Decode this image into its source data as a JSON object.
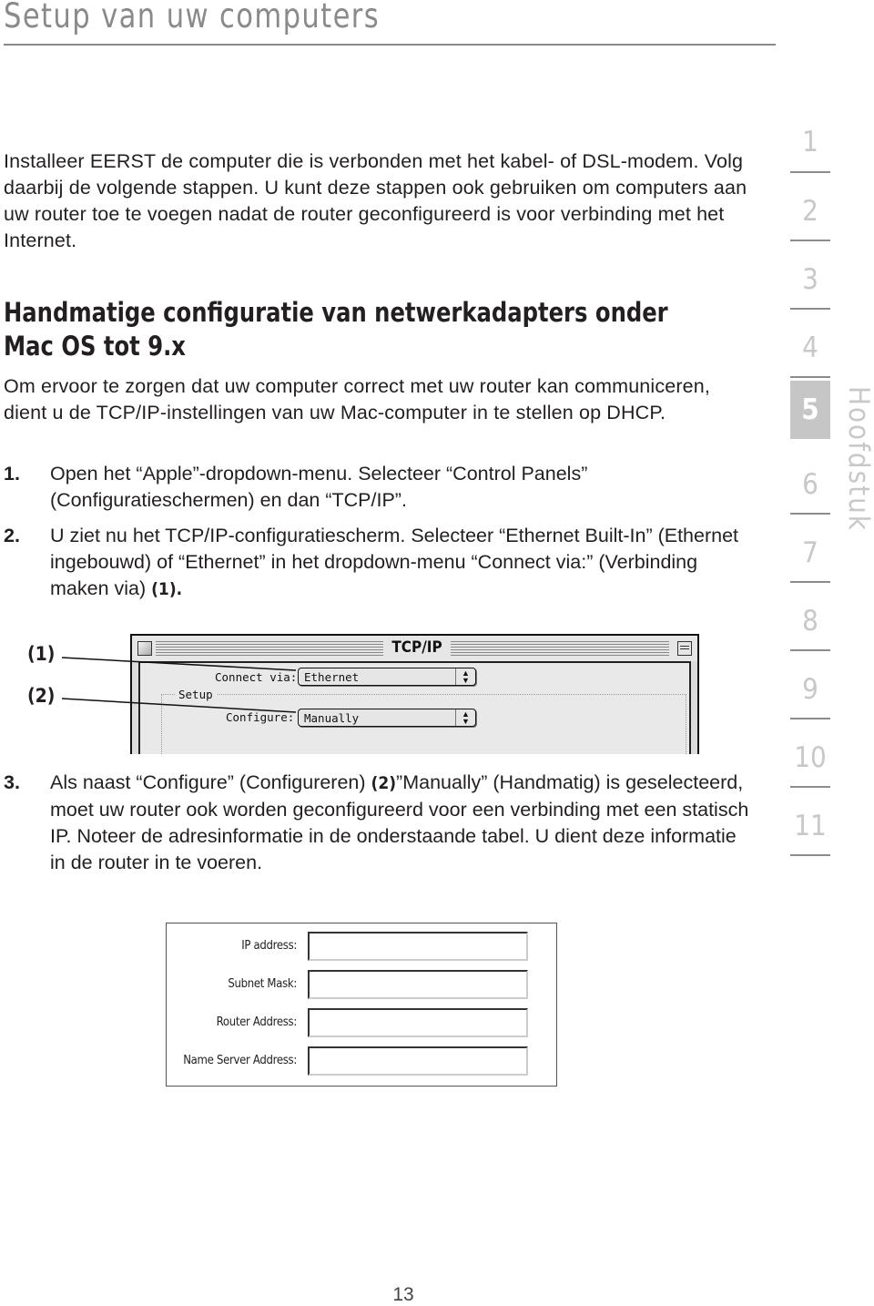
{
  "header": {
    "title": "Setup van uw computers"
  },
  "intro": "Installeer EERST de computer die is verbonden met het kabel- of DSL-modem. Volg daarbij de volgende stappen. U kunt deze stappen ook gebruiken om computers aan uw router toe te voegen nadat de router geconfigureerd is voor verbinding met het Internet.",
  "section": {
    "heading": "Handmatige configuratie van netwerkadapters onder Mac OS tot 9.x",
    "paragraph": "Om ervoor te zorgen dat uw computer correct met uw router kan communiceren, dient u de TCP/IP-instellingen van uw Mac-computer in te stellen op DHCP."
  },
  "steps": [
    {
      "number": "1.",
      "text": "Open het “Apple”-dropdown-menu. Selecteer “Control Panels” (Configuratieschermen) en dan “TCP/IP”."
    },
    {
      "number": "2.",
      "text": "U ziet nu het TCP/IP-configuratiescherm. Selecteer “Ethernet Built-In” (Ethernet ingebouwd) of “Ethernet” in het dropdown-menu “Connect via:” (Verbinding maken via) ",
      "ref": "(1)."
    },
    {
      "number": "3.",
      "text_before": "Als naast “Configure” (Configureren) ",
      "ref": "(2)",
      "text_after": "”Manually” (Handmatig) is geselecteerd, moet uw router ook worden geconfigureerd voor een verbinding met een statisch IP. Noteer de adresinformatie in de onderstaande tabel. U dient deze informatie in de router in te voeren."
    }
  ],
  "dialog": {
    "title": "TCP/IP",
    "callouts": [
      "(1)",
      "(2)"
    ],
    "connect_via_label": "Connect via:",
    "connect_via_value": "Ethernet",
    "setup_group_label": "Setup",
    "configure_label": "Configure:",
    "configure_value": "Manually"
  },
  "address_table": {
    "rows": [
      {
        "label": "IP address:",
        "value": ""
      },
      {
        "label": "Subnet Mask:",
        "value": ""
      },
      {
        "label": "Router Address:",
        "value": ""
      },
      {
        "label": "Name Server Address:",
        "value": ""
      }
    ]
  },
  "sidebar": {
    "chapters": [
      "1",
      "2",
      "3",
      "4",
      "5",
      "6",
      "7",
      "8",
      "9",
      "10",
      "11"
    ],
    "active_chapter": "5",
    "label": "Hoofdstuk"
  },
  "footer": {
    "page_number": "13"
  }
}
